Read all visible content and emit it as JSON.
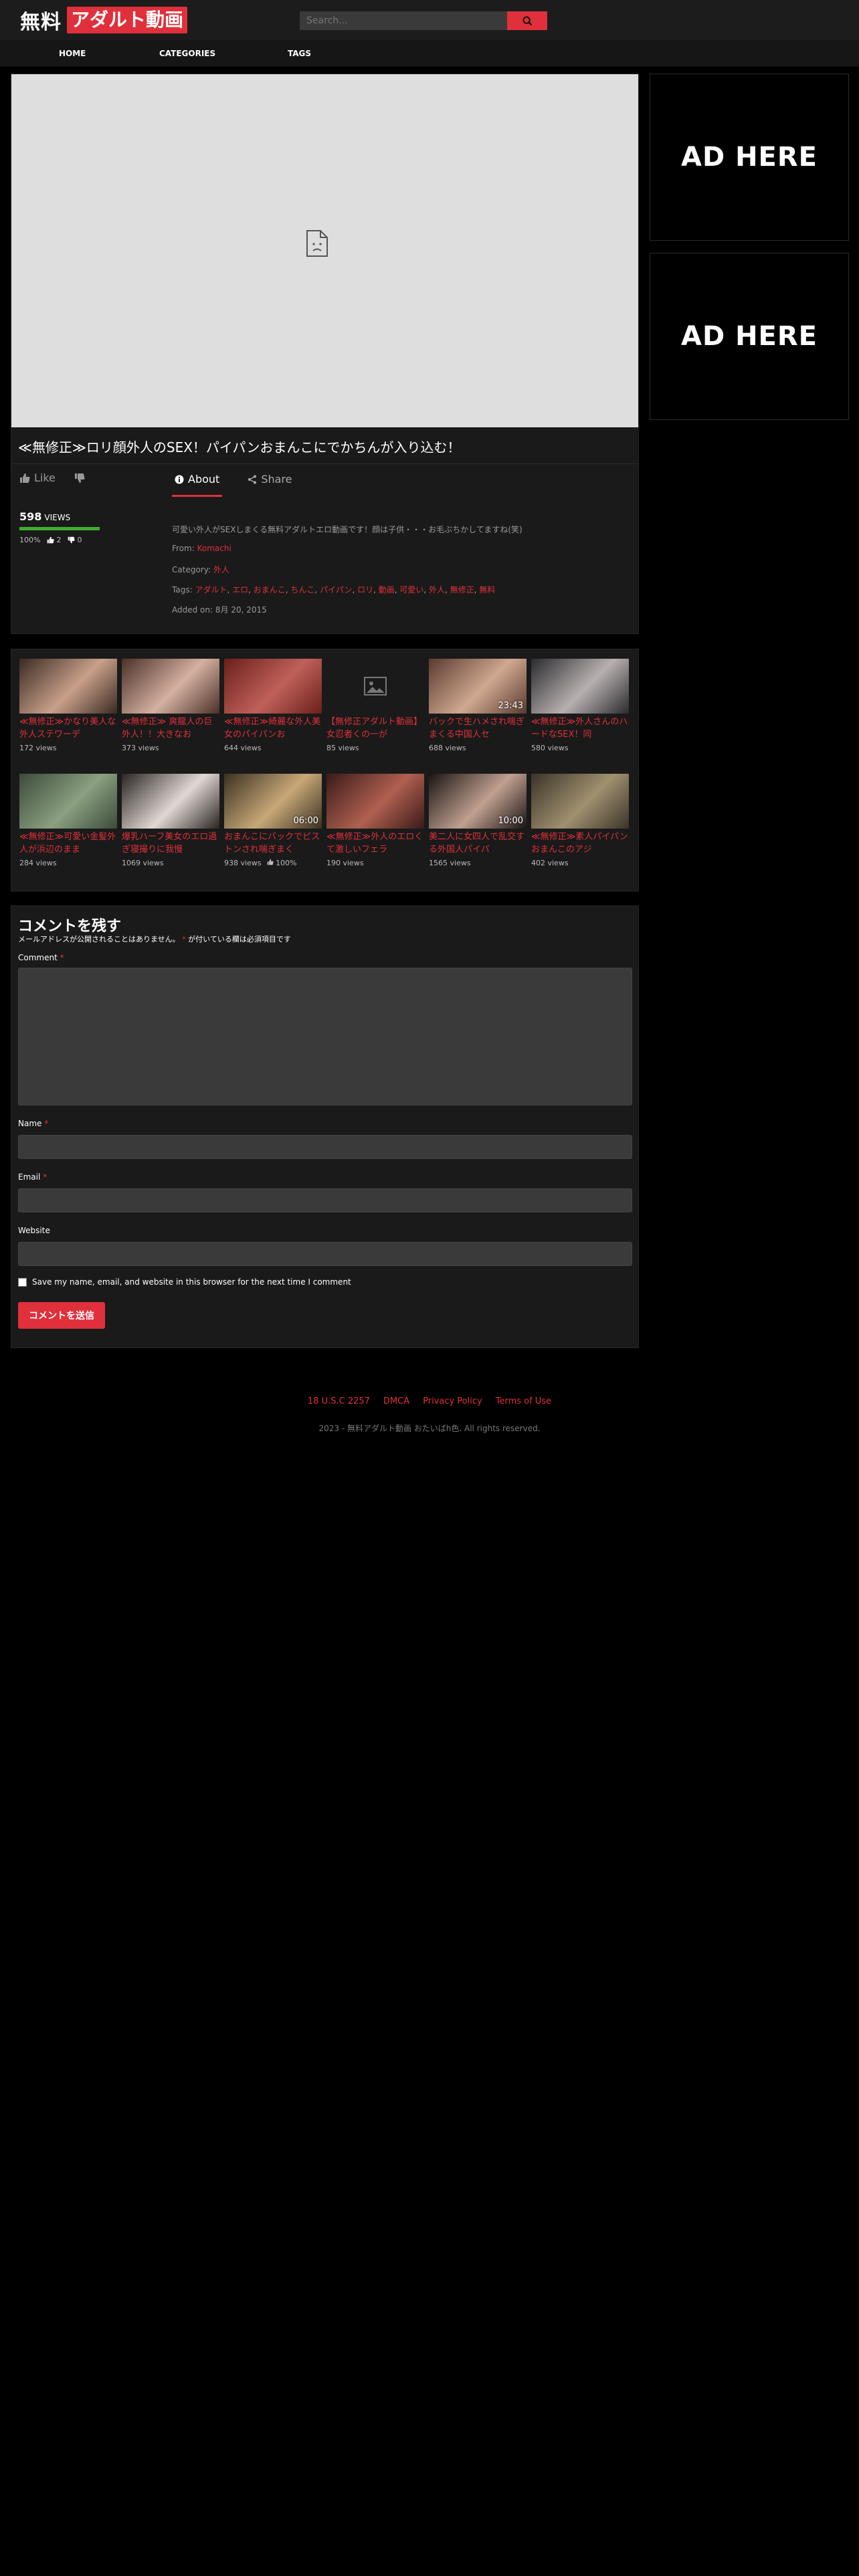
{
  "site": {
    "logo_primary": "無料",
    "logo_accent": "アダルト動画",
    "accent_color": "#e0303b"
  },
  "search": {
    "placeholder": "Search...",
    "icon": "search-icon"
  },
  "nav": [
    "HOME",
    "CATEGORIES",
    "TAGS"
  ],
  "video": {
    "title": "≪無修正≫ロリ顔外人のSEX！パイパンおまんこにでかちんが入り込む！",
    "like_label": "Like",
    "tabs": [
      "About",
      "Share"
    ],
    "views_count": "598",
    "views_label": "VIEWS",
    "rating_percent": "100%",
    "rating": 1.0,
    "likes": "2",
    "dislikes": "0",
    "description": "可愛い外人がSEXしまくる無料アダルトエロ動画です！顔は子供・・・お毛ぶちかしてますね(笑)",
    "from_label": "From:",
    "from": "Komachi",
    "category_label": "Category:",
    "category": "外人",
    "tags_label": "Tags:",
    "tags": [
      "アダルト",
      "エロ",
      "おまんこ",
      "ちんこ",
      "パイパン",
      "ロリ",
      "動画",
      "可愛い",
      "外人",
      "無修正",
      "無料"
    ],
    "added_label": "Added on:",
    "added": "8月 20, 2015"
  },
  "ads": [
    "AD HERE",
    "AD HERE"
  ],
  "related": [
    {
      "title": "≪無修正≫かなり美人な外人ステワーデ",
      "views": "172 views",
      "duration": "",
      "thumb": [
        "#3a2a22",
        "#c9a08a"
      ]
    },
    {
      "title": "≪無修正≫ 爽龍人の巨外人！！大きなお",
      "views": "373 views",
      "duration": "",
      "thumb": [
        "#4a3028",
        "#d4b0a0"
      ]
    },
    {
      "title": "≪無修正≫綺麗な外人美女のパイパンお",
      "views": "644 views",
      "duration": "",
      "thumb": [
        "#6a1f1a",
        "#c0605a"
      ]
    },
    {
      "title": "【無修正アダルト動画】 女忍者くの一が",
      "views": "85 views",
      "duration": "",
      "thumb": null
    },
    {
      "title": "バックで生ハメされ喘ぎまくる中国人セ",
      "views": "688 views",
      "duration": "23:43",
      "thumb": [
        "#5a3a30",
        "#d0a890"
      ]
    },
    {
      "title": "≪無修正≫外人さんのハードなSEX！同",
      "views": "580 views",
      "duration": "",
      "thumb": [
        "#2a2a2e",
        "#b8b0b0"
      ]
    },
    {
      "title": "≪無修正≫可愛い金髪外人が浜辺のまま",
      "views": "284 views",
      "duration": "",
      "thumb": [
        "#3c4a3a",
        "#8aa080"
      ]
    },
    {
      "title": "爆乳ハーフ美女のエロ過ぎ寝撮りに我慢",
      "views": "1069 views",
      "duration": "",
      "thumb": [
        "#2a2422",
        "#e0d8d4"
      ]
    },
    {
      "title": "おまんこにバックでピストンされ喘ぎまく",
      "views": "938 views",
      "duration": "06:00",
      "thumb": [
        "#3a3020",
        "#c8a878"
      ],
      "rating": "100%"
    },
    {
      "title": "≪無修正≫外人のエロくて激しいフェラ",
      "views": "190 views",
      "duration": "",
      "thumb": [
        "#3a1a18",
        "#b06050"
      ]
    },
    {
      "title": "美二人に女四人で乱交する外国人パイパ",
      "views": "1565 views",
      "duration": "10:00",
      "thumb": [
        "#1a1412",
        "#c0a090"
      ]
    },
    {
      "title": "≪無修正≫素人パイパンおまんこのアジ",
      "views": "402 views",
      "duration": "",
      "thumb": [
        "#3a3428",
        "#a09070"
      ]
    }
  ],
  "comments": {
    "title": "コメントを残す",
    "note_a": "メールアドレスが公開されることはありません。",
    "note_b": "が付いている欄は必須項目です",
    "required_mark": "*",
    "comment_label": "Comment",
    "name_label": "Name",
    "email_label": "Email",
    "website_label": "Website",
    "save_label": "Save my name, email, and website in this browser for the next time I comment",
    "submit_label": "コメントを送信"
  },
  "footer": {
    "links": [
      "18 U.S.C 2257",
      "DMCA",
      "Privacy Policy",
      "Terms of Use"
    ],
    "copyright": "2023 - 無料アダルト動画 おたいばh色. All rights reserved."
  }
}
